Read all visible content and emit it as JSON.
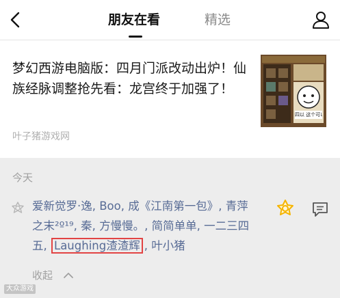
{
  "nav": {
    "tabs": [
      "朋友在看",
      "精选"
    ],
    "active_tab_index": 0
  },
  "article": {
    "title": "梦幻西游电脑版：四月门派改动出炉！仙族经脉调整抢先看：龙宫终于加强了！",
    "source": "叶子猪游戏网",
    "thumbnail_caption": "四以 这个可以有"
  },
  "friends_section": {
    "label": "今天",
    "names_before_highlight": "爱新觉罗·逸, Boo, 成《江南第一包》, 青萍之末²º¹⁹, 秦, 方慢慢。, 简简单单, 一二三四五, ",
    "highlighted_name": "Laughing渣渣辉",
    "names_after_highlight": ", 叶小猪",
    "collapse_label": "收起"
  },
  "watermark": "大众游戏",
  "colors": {
    "link_blue": "#576b95",
    "highlight_red": "#e24343",
    "wow_yellow": "#f5b400",
    "muted_gray": "#a0a0a0"
  }
}
